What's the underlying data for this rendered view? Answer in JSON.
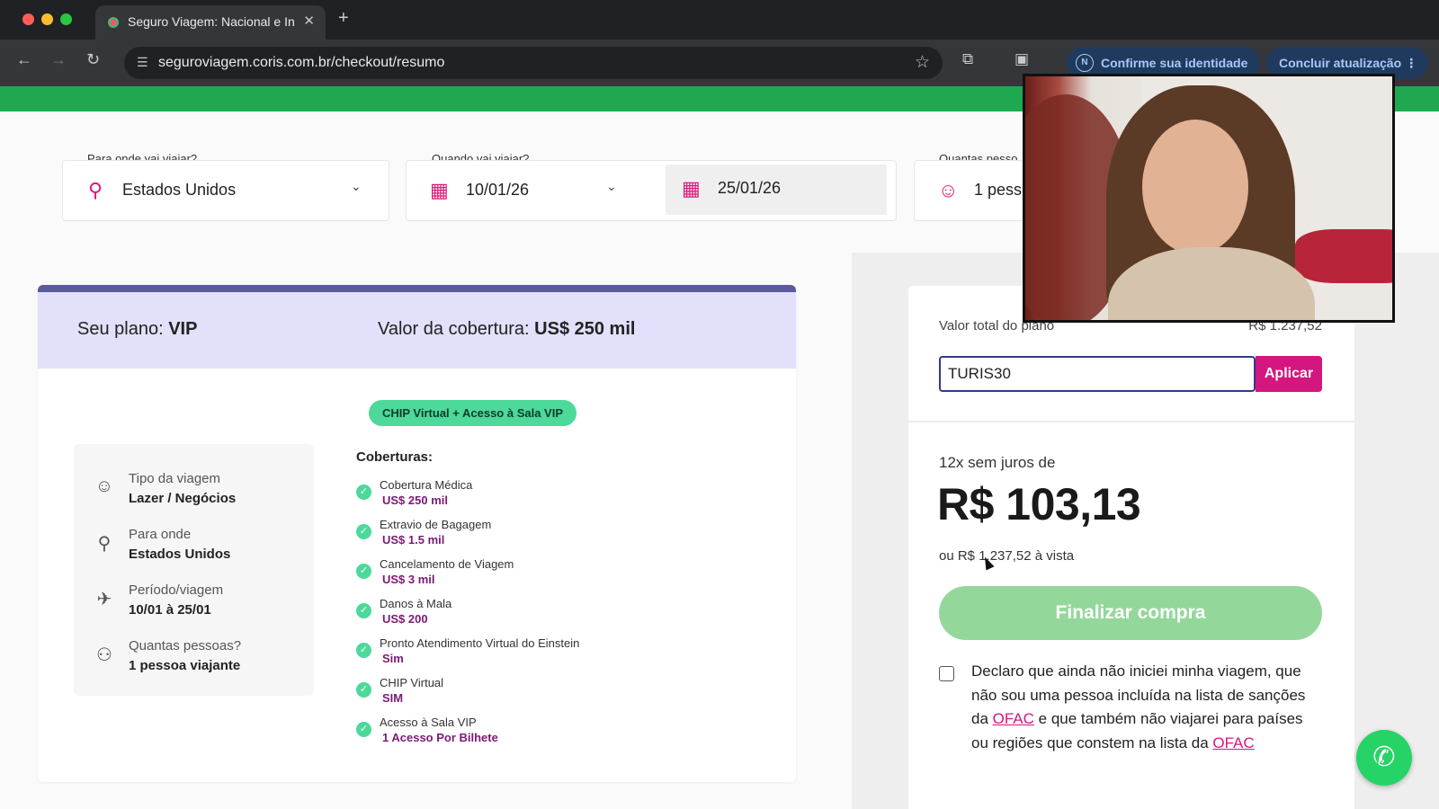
{
  "browser": {
    "tab_title": "Seguro Viagem: Nacional e In",
    "tab_close": "✕",
    "new_tab": "+",
    "url": "seguroviagem.coris.com.br/checkout/resumo",
    "identity_pill": "Confirme sua identidade",
    "identity_badge": "N",
    "update_pill": "Concluir atualização",
    "icons": [
      "back-icon",
      "forward-icon",
      "reload-icon",
      "site-settings-icon",
      "star-icon",
      "extensions-icon",
      "tab-search-icon",
      "menu-icon"
    ]
  },
  "search": {
    "destination_label": "Para onde vai viajar?",
    "destination_value": "Estados Unidos",
    "when_label": "Quando vai viajar?",
    "start_date": "10/01/26",
    "end_date": "25/01/26",
    "people_label": "Quantas pesso",
    "people_value": "1 pess"
  },
  "plan": {
    "plan_prefix": "Seu plano: ",
    "plan_name": "VIP",
    "coverage_prefix": "Valor da cobertura: ",
    "coverage_value": "US$ 250 mil",
    "badge": "CHIP Virtual + Acesso à Sala VIP",
    "trip": [
      {
        "label": "Tipo da viagem",
        "value": "Lazer / Negócios"
      },
      {
        "label": "Para onde",
        "value": "Estados Unidos"
      },
      {
        "label": "Período/viagem",
        "value": "10/01 à 25/01"
      },
      {
        "label": "Quantas pessoas?",
        "value": "1 pessoa viajante"
      }
    ],
    "coverages_title": "Coberturas:",
    "coverages": [
      {
        "name": "Cobertura Médica",
        "value": "US$ 250 mil"
      },
      {
        "name": "Extravio de Bagagem",
        "value": "US$ 1.5 mil"
      },
      {
        "name": "Cancelamento de Viagem",
        "value": "US$ 3 mil"
      },
      {
        "name": "Danos à Mala",
        "value": "US$ 200"
      },
      {
        "name": "Pronto Atendimento Virtual do Einstein",
        "value": "Sim"
      },
      {
        "name": "CHIP Virtual",
        "value": "SIM"
      },
      {
        "name": "Acesso à Sala VIP",
        "value": "1 Acesso Por Bilhete"
      }
    ]
  },
  "summary": {
    "total_label": "Valor total do plano",
    "total_value": "R$ 1.237,52",
    "coupon_value": "TURIS30",
    "coupon_button": "Aplicar",
    "installments_label": "12x sem juros de",
    "installment_value": "R$ 103,13",
    "cash_value": "ou R$ 1.237,52 à vista",
    "finish_button": "Finalizar compra",
    "declaration_part1": "Declaro que ainda não iniciei minha viagem, que não sou uma pessoa incluída na lista de sanções da ",
    "declaration_link1": "OFAC",
    "declaration_part2": " e que também não viajarei para países ou regiões que constem na lista da ",
    "declaration_link2": "OFAC"
  },
  "colors": {
    "brand_green": "#1fa84f",
    "brand_magenta": "#d4167f",
    "plan_header": "#e2e0fa",
    "badge_green": "#4cd99a",
    "finish_disabled": "#93d89a"
  }
}
